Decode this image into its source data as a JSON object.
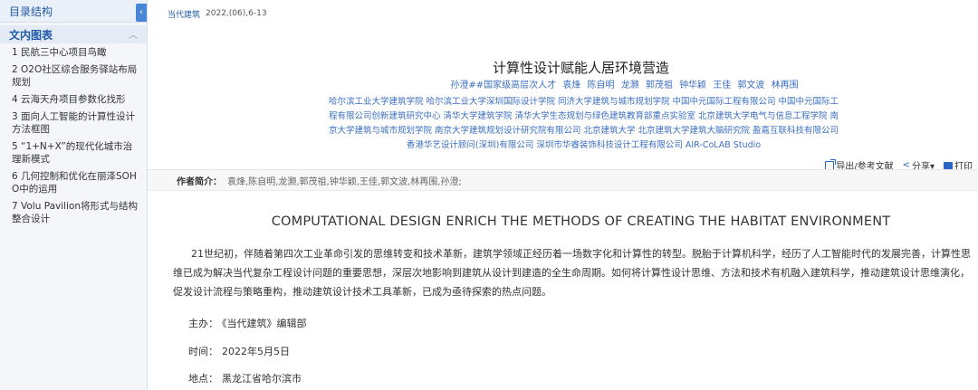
{
  "sidebar": {
    "header": "目录结构",
    "collapse_icon": "‹",
    "section_title": "文内图表",
    "section_chevron": "︿",
    "items": [
      "1 民航三中心项目鸟瞰",
      "2 O2O社区综合服务驿站布局规划",
      "4 云海天舟项目参数化找形",
      "3 面向人工智能的计算性设计方法框图",
      "5 “1+N+X”的现代化城市治理新模式",
      "6 几何控制和优化在丽泽SOHO中的运用",
      "7 Volu Pavilion将形式与结构整合设计"
    ]
  },
  "header": {
    "journal": "当代建筑",
    "issue": "2022,(06),6-13"
  },
  "article": {
    "title_cn": "计算性设计赋能人居环境营造",
    "authors": [
      "孙澄##国家级高层次人才",
      "袁烽",
      "陈自明",
      "龙灏",
      "郭茂祖",
      "钟华颖",
      "王佳",
      "郭文波",
      "林再围"
    ],
    "affiliations": "哈尔滨工业大学建筑学院  哈尔滨工业大学深圳国际设计学院  同济大学建筑与城市规划学院  中国中元国际工程有限公司  中国中元国际工程有限公司创新建筑研究中心  清华大学建筑学院  清华大学生态规划与绿色建筑教育部重点实验室  北京建筑大学电气与信息工程学院  南京大学建筑与城市规划学院  南京大学建筑规划设计研究院有限公司  北京建筑大学  北京建筑大学建筑大脑研究院  盈嘉互联科技有限公司  香港华艺设计顾问(深圳)有限公司  深圳市华睿装饰科技设计工程有限公司  AIR-CoLAB Studio",
    "author_intro_label": "作者简介：",
    "author_intro_value": "袁烽,陈自明,龙灏,郭茂祖,钟华颖,王佳,郭文波,林再围,孙澄;",
    "title_en": "COMPUTATIONAL DESIGN ENRICH THE METHODS OF CREATING THE HABITAT ENVIRONMENT",
    "abstract": "21世纪初，伴随着第四次工业革命引发的思维转变和技术革新，建筑学领域正经历着一场数字化和计算性的转型。脱胎于计算机科学，经历了人工智能时代的发展完善，计算性思维已成为解决当代复杂工程设计问题的重要思想，深层次地影响到建筑从设计到建造的全生命周期。如何将计算性设计思维、方法和技术有机融入建筑科学，推动建筑设计思维演化，促发设计流程与策略重构，推动建筑设计技术工具革新，已成为亟待探索的热点问题。",
    "host_label": "主办：",
    "host_value": "《当代建筑》编辑部",
    "time_label": "时间：",
    "time_value": "2022年5月5日",
    "place_label": "地点：",
    "place_value": "黑龙江省哈尔滨市"
  },
  "toolbar": {
    "export_label": "导出/参考文献",
    "share_label": "分享▾",
    "print_label": "打印",
    "export_icon": "export-icon",
    "share_icon": "share-icon",
    "print_icon": "print-icon"
  }
}
